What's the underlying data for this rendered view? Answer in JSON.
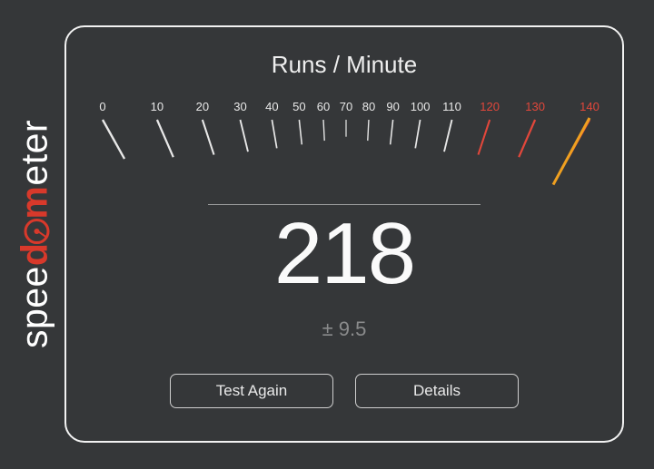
{
  "logo": {
    "part1": "spee",
    "part2_d": "d",
    "part3_m": "m",
    "part4": "eter"
  },
  "title": "Runs / Minute",
  "score": "218",
  "variance": "± 9.5",
  "buttons": {
    "test_again": "Test Again",
    "details": "Details"
  },
  "gauge": {
    "ticks": [
      {
        "label": "0",
        "red": false
      },
      {
        "label": "10",
        "red": false
      },
      {
        "label": "20",
        "red": false
      },
      {
        "label": "30",
        "red": false
      },
      {
        "label": "40",
        "red": false
      },
      {
        "label": "50",
        "red": false
      },
      {
        "label": "60",
        "red": false
      },
      {
        "label": "70",
        "red": false
      },
      {
        "label": "80",
        "red": false
      },
      {
        "label": "90",
        "red": false
      },
      {
        "label": "100",
        "red": false
      },
      {
        "label": "110",
        "red": false
      },
      {
        "label": "120",
        "red": true
      },
      {
        "label": "130",
        "red": true
      },
      {
        "label": "140",
        "red": true
      }
    ],
    "needle_value": 218,
    "needle_max": 140
  }
}
